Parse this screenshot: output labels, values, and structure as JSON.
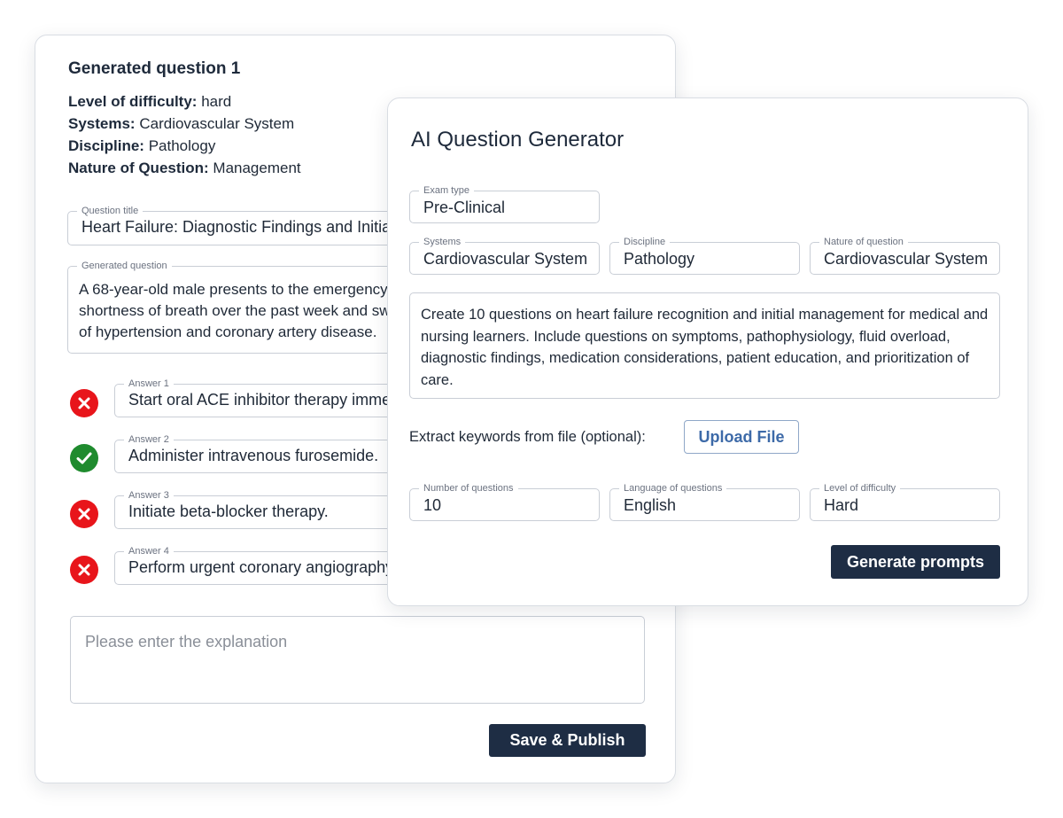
{
  "back_card": {
    "heading": "Generated question 1",
    "meta": [
      {
        "label": "Level of difficulty:",
        "value": "hard"
      },
      {
        "label": "Systems:",
        "value": "Cardiovascular System"
      },
      {
        "label": "Discipline:",
        "value": "Pathology"
      },
      {
        "label": "Nature of Question:",
        "value": "Management"
      }
    ],
    "question_title": {
      "legend": "Question title",
      "value": "Heart Failure: Diagnostic Findings and Initial Management"
    },
    "generated_question": {
      "legend": "Generated question",
      "value": "A 68-year-old male presents to the emergency department with progressive shortness of breath over the past week and swelling of both legs. He has a history of hypertension and coronary artery disease."
    },
    "answers": [
      {
        "legend": "Answer 1",
        "value": "Start oral ACE inhibitor therapy immediately.",
        "correct": false
      },
      {
        "legend": "Answer 2",
        "value": "Administer intravenous furosemide.",
        "correct": true
      },
      {
        "legend": "Answer 3",
        "value": "Initiate beta-blocker therapy.",
        "correct": false
      },
      {
        "legend": "Answer 4",
        "value": "Perform urgent coronary angiography.",
        "correct": false
      }
    ],
    "explanation_placeholder": "Please enter the explanation",
    "save_label": "Save & Publish"
  },
  "front_card": {
    "title": "AI Question Generator",
    "exam_type": {
      "legend": "Exam type",
      "value": "Pre-Clinical"
    },
    "systems": {
      "legend": "Systems",
      "value": "Cardiovascular System"
    },
    "discipline": {
      "legend": "Discipline",
      "value": "Pathology"
    },
    "nature": {
      "legend": "Nature of question",
      "value": "Cardiovascular System"
    },
    "prompt": "Create 10 questions on heart failure recognition and initial management for medical and nursing learners. Include questions on symptoms, pathophysiology, fluid overload, diagnostic findings, medication considerations, patient education, and prioritization of care.",
    "extract_label": "Extract keywords from file (optional):",
    "upload_label": "Upload File",
    "num_questions": {
      "legend": "Number of questions",
      "value": "10"
    },
    "language": {
      "legend": "Language of questions",
      "value": "English"
    },
    "difficulty": {
      "legend": "Level of difficulty",
      "value": "Hard"
    },
    "generate_label": "Generate prompts"
  },
  "colors": {
    "primary_dark": "#1e2d44",
    "wrong": "#e8151b",
    "correct": "#1f8b2e",
    "link_blue": "#3d6aa8"
  },
  "icons": {
    "wrong": "close-icon",
    "correct": "check-icon"
  }
}
